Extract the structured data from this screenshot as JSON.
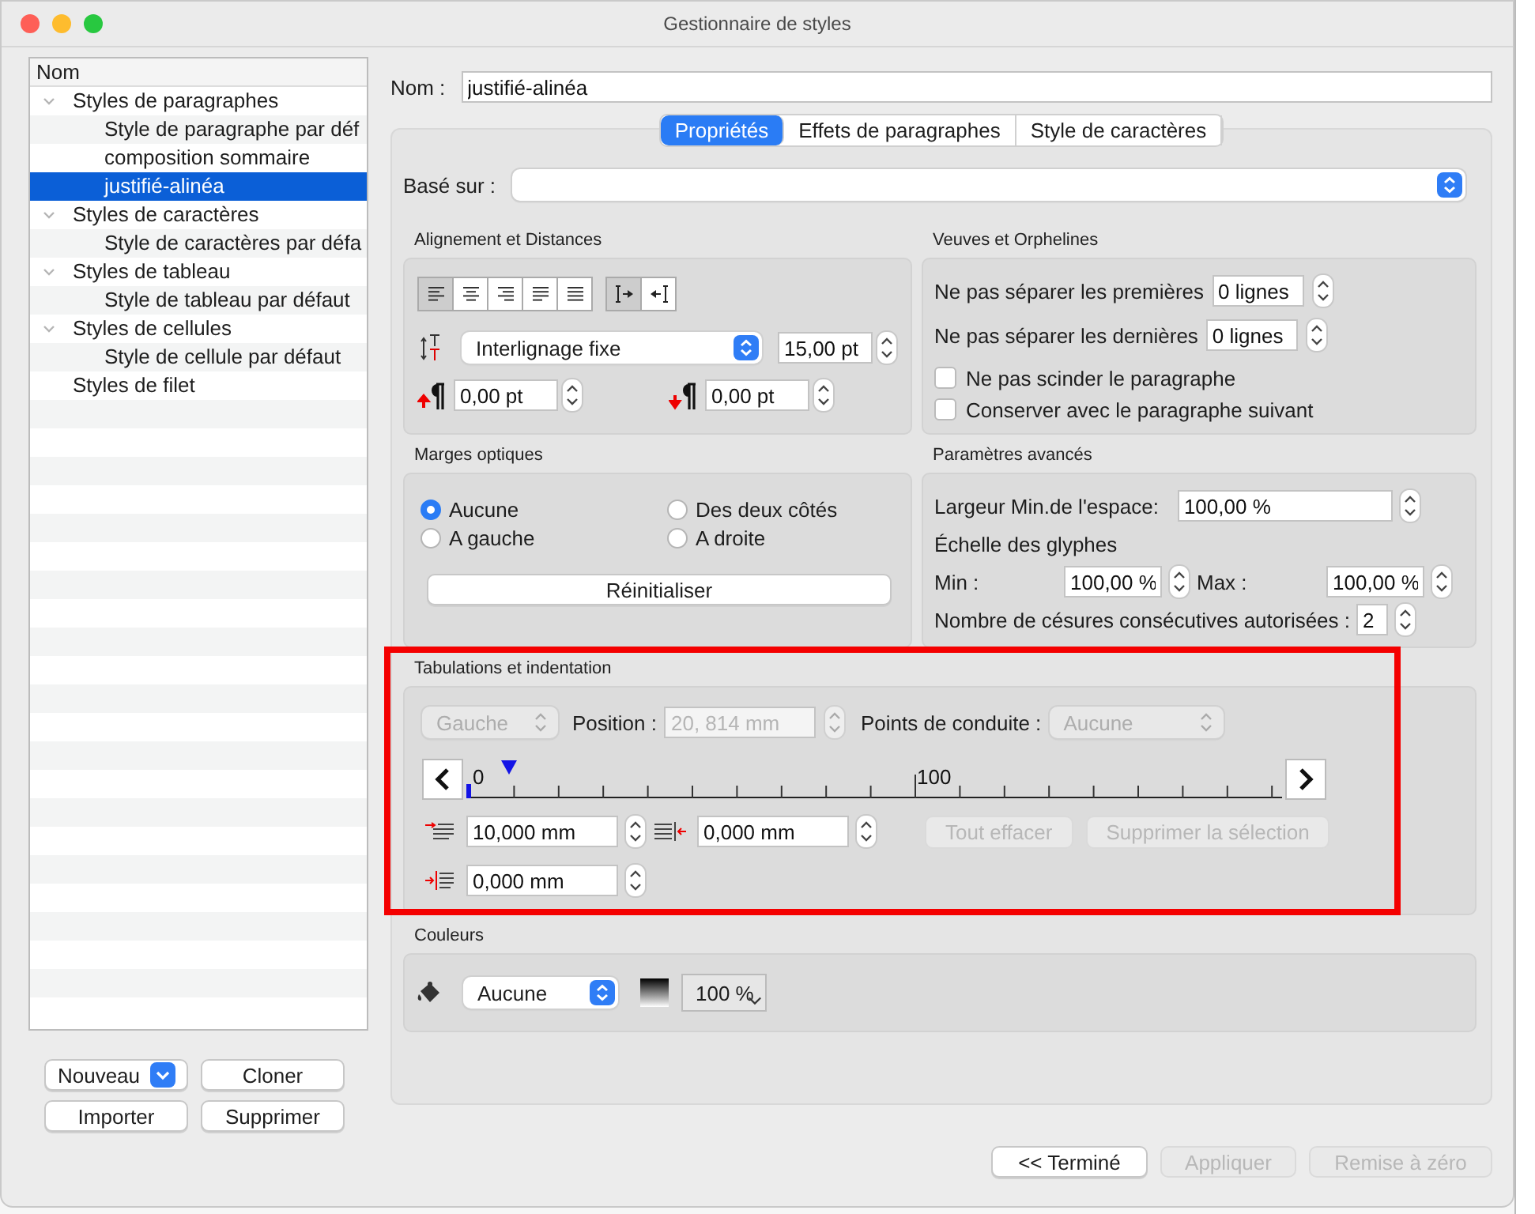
{
  "window": {
    "title": "Gestionnaire de styles"
  },
  "style_list": {
    "header": "Nom",
    "items": [
      {
        "label": "Styles de paragraphes",
        "expanded": true,
        "selected": false,
        "children": [
          {
            "label": "Style de paragraphe par déf",
            "selected": false
          },
          {
            "label": "composition sommaire",
            "selected": false
          },
          {
            "label": "justifié-alinéa",
            "selected": true
          }
        ]
      },
      {
        "label": "Styles de caractères",
        "expanded": true,
        "selected": false,
        "children": [
          {
            "label": "Style de caractères par défa",
            "selected": false
          }
        ]
      },
      {
        "label": "Styles de tableau",
        "expanded": true,
        "selected": false,
        "children": [
          {
            "label": "Style de tableau par défaut",
            "selected": false
          }
        ]
      },
      {
        "label": "Styles de cellules",
        "expanded": true,
        "selected": false,
        "children": [
          {
            "label": "Style de cellule par défaut",
            "selected": false
          }
        ]
      },
      {
        "label": "Styles de filet",
        "selected": false
      }
    ]
  },
  "list_buttons": [
    {
      "label": "Nouveau",
      "kind": "menu"
    },
    {
      "label": "Cloner",
      "kind": "plain"
    },
    {
      "label": "Importer",
      "kind": "plain"
    },
    {
      "label": "Supprimer",
      "kind": "plain"
    }
  ],
  "name_field": {
    "label": "Nom :",
    "value": "justifié-alinéa"
  },
  "tabs": [
    {
      "label": "Propriétés",
      "selected": true
    },
    {
      "label": "Effets de paragraphes",
      "selected": false
    },
    {
      "label": "Style de caractères",
      "selected": false
    }
  ],
  "based_on": {
    "label": "Basé sur :"
  },
  "alignment": {
    "title": "Alignement et Distances",
    "align_buttons": [
      {
        "kind": "left",
        "selected": true
      },
      {
        "kind": "center",
        "selected": false
      },
      {
        "kind": "right",
        "selected": false
      },
      {
        "kind": "justify",
        "selected": false
      },
      {
        "kind": "justify-all",
        "selected": false
      }
    ],
    "direction_buttons": [
      {
        "kind": "ltr",
        "selected": true
      },
      {
        "kind": "rtl",
        "selected": false
      }
    ],
    "line_spacing": "Interlignage fixe",
    "spacing_value": "15,00 pt",
    "space_before": "0,00 pt",
    "space_after": "0,00 pt"
  },
  "widows": {
    "title": "Veuves et Orphelines",
    "rows": [
      {
        "label": "Ne pas séparer les premières",
        "value": "0 lignes"
      },
      {
        "label": "Ne pas séparer les dernières",
        "value": "0 lignes"
      }
    ],
    "checkboxes": [
      {
        "label": "Ne pas scinder le paragraphe",
        "checked": false
      },
      {
        "label": "Conserver avec le paragraphe suivant",
        "checked": false
      }
    ]
  },
  "optical_margins": {
    "title": "Marges optiques",
    "options": [
      {
        "label": "Aucune",
        "selected": true
      },
      {
        "label": "Des deux côtés",
        "selected": false
      },
      {
        "label": "A gauche",
        "selected": false
      },
      {
        "label": "A droite",
        "selected": false
      }
    ],
    "reset_button": "Réinitialiser"
  },
  "advanced": {
    "title": "Paramètres avancés",
    "min_space": {
      "label": "Largeur Min.de l'espace:",
      "value": "100,00 %"
    },
    "glyph_scale": "Échelle des glyphes",
    "min": {
      "label": "Min :",
      "value": "100,00 %"
    },
    "max": {
      "label": "Max :",
      "value": "100,00 %"
    },
    "hyphens": {
      "label": "Nombre de césures consécutives autorisées :",
      "value": "2"
    }
  },
  "tabs_indent": {
    "title": "Tabulations et indentation",
    "alignment": {
      "value": "Gauche",
      "disabled": true
    },
    "position": {
      "label": "Position :",
      "value": "20, 814 mm",
      "disabled": true
    },
    "leader": {
      "label": "Points de conduite :",
      "value": "Aucune",
      "disabled": true
    },
    "ruler_labels": [
      "0",
      "100"
    ],
    "first_indent": "10,000 mm",
    "right_indent": "0,000 mm",
    "left_indent": "0,000 mm",
    "actions": [
      {
        "label": "Tout effacer",
        "disabled": true
      },
      {
        "label": "Supprimer la sélection",
        "disabled": true
      }
    ]
  },
  "colors": {
    "title": "Couleurs",
    "fill_choice": "Aucune",
    "shade": "100 %"
  },
  "footer_buttons": [
    {
      "label": "<< Terminé",
      "disabled": false
    },
    {
      "label": "Appliquer",
      "disabled": true
    },
    {
      "label": "Remise à zéro",
      "disabled": true
    }
  ]
}
